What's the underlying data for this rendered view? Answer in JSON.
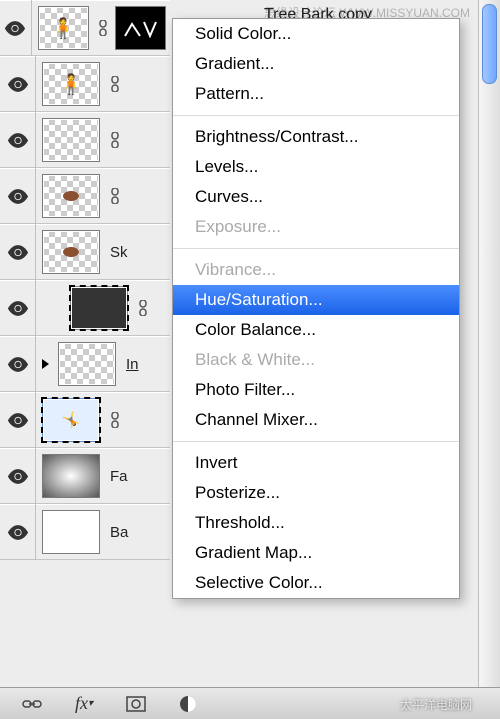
{
  "watermark_top": "思缘设计论坛  WWW.MISSYUAN.COM",
  "watermark_bottom": "太平洋电脑网",
  "layers": {
    "top_label": "Tree Bark copy",
    "sk": "Sk",
    "in": "In",
    "fa": "Fa",
    "ba": "Ba"
  },
  "menu": {
    "solid_color": "Solid Color...",
    "gradient": "Gradient...",
    "pattern": "Pattern...",
    "brightness_contrast": "Brightness/Contrast...",
    "levels": "Levels...",
    "curves": "Curves...",
    "exposure": "Exposure...",
    "vibrance": "Vibrance...",
    "hue_saturation": "Hue/Saturation...",
    "color_balance": "Color Balance...",
    "black_white": "Black & White...",
    "photo_filter": "Photo Filter...",
    "channel_mixer": "Channel Mixer...",
    "invert": "Invert",
    "posterize": "Posterize...",
    "threshold": "Threshold...",
    "gradient_map": "Gradient Map...",
    "selective_color": "Selective Color..."
  }
}
